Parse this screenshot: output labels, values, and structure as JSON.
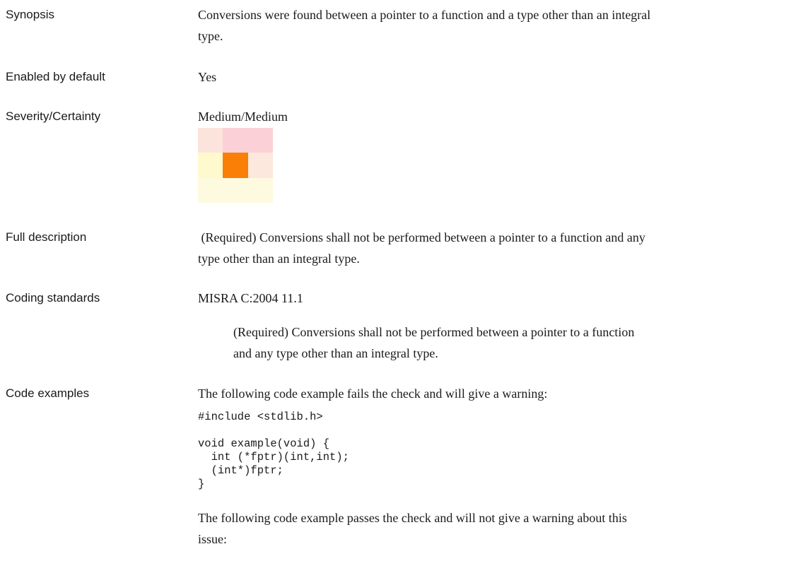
{
  "rows": {
    "synopsis": {
      "label": "Synopsis",
      "text_line1": "Conversions were found between a pointer to a function and a type other than an integral",
      "text_line2": "type."
    },
    "enabled": {
      "label": "Enabled by default",
      "text": "Yes"
    },
    "severity": {
      "label": "Severity/Certainty",
      "text": "Medium/Medium",
      "grid_colors": [
        [
          "#fce3dc",
          "#fbd0d6",
          "#fbd0d6"
        ],
        [
          "#fefacd",
          "#f97f07",
          "#fce8dc"
        ],
        [
          "#fefae0",
          "#fefae0",
          "#fefae0"
        ]
      ],
      "grid_names": [
        [
          "sev-low-cert-high",
          "sev-med-cert-high",
          "sev-high-cert-high"
        ],
        [
          "sev-low-cert-med",
          "sev-med-cert-med",
          "sev-high-cert-med"
        ],
        [
          "sev-low-cert-low",
          "sev-med-cert-low",
          "sev-high-cert-low"
        ]
      ]
    },
    "full_description": {
      "label": "Full description",
      "text_line1": " (Required) Conversions shall not be performed between a pointer to a function and any",
      "text_line2": "type other than an integral type."
    },
    "coding_standards": {
      "label": "Coding standards",
      "standard": "MISRA C:2004 11.1",
      "quote_line1": "(Required) Conversions shall not be performed between a pointer to a function",
      "quote_line2": "and any type other than an integral type."
    },
    "code_examples": {
      "label": "Code examples",
      "intro_fail": "The following code example fails the check and will give a warning:",
      "include_line": "#include <stdlib.h>",
      "code_lines": [
        "void example(void) {",
        "  int (*fptr)(int,int);",
        "  (int*)fptr;",
        "}"
      ],
      "intro_pass_line1": "The following code example passes the check and will not give a warning about this",
      "intro_pass_line2": "issue:"
    }
  }
}
